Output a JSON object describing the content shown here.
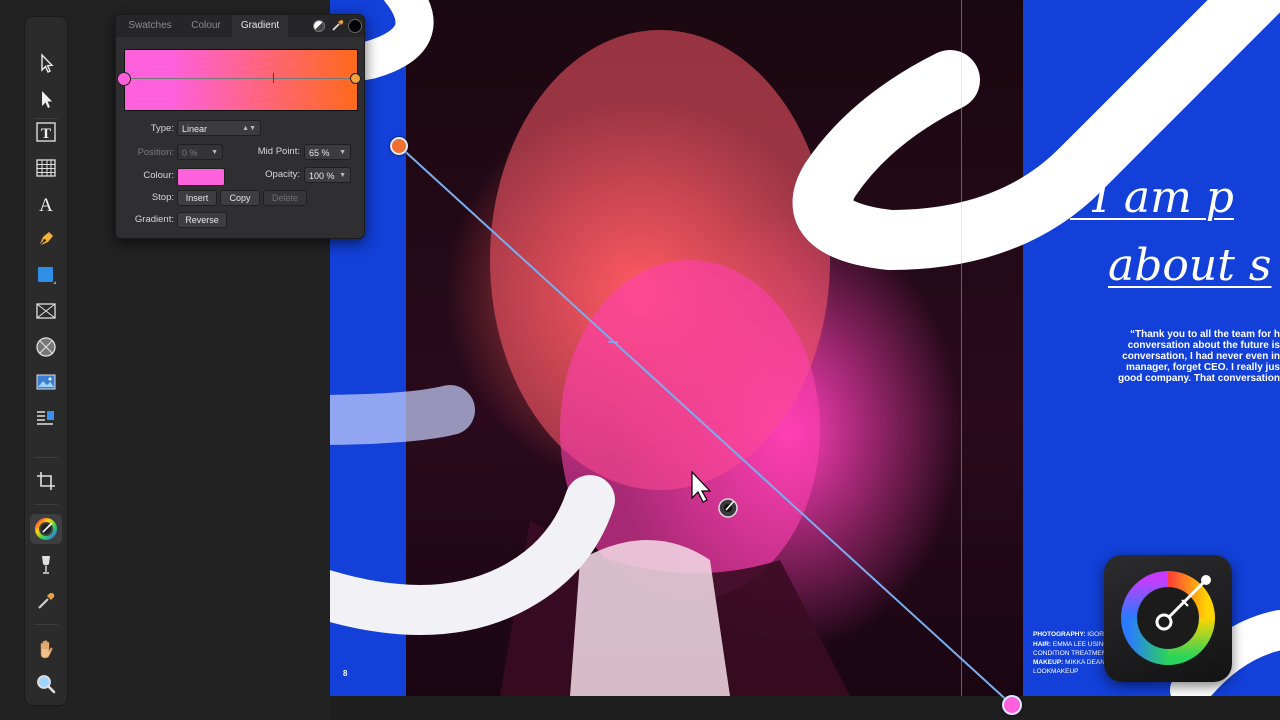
{
  "toolbar": {
    "tools": [
      {
        "name": "move-tool"
      },
      {
        "name": "node-tool"
      },
      {
        "name": "frame-text-tool"
      },
      {
        "name": "table-tool"
      },
      {
        "name": "artistic-text-tool",
        "glyph": "A"
      },
      {
        "name": "pen-tool"
      },
      {
        "name": "shape-tool"
      },
      {
        "name": "picture-frame-tool"
      },
      {
        "name": "ellipse-frame-tool"
      },
      {
        "name": "place-image-tool"
      },
      {
        "name": "text-wrap-tool"
      },
      {
        "name": "crop-tool"
      },
      {
        "name": "fill-tool"
      },
      {
        "name": "transparency-tool"
      },
      {
        "name": "colour-picker-tool"
      },
      {
        "name": "hand-tool"
      },
      {
        "name": "zoom-tool"
      }
    ]
  },
  "gradient_panel": {
    "tabs": [
      "Swatches",
      "Colour",
      "Gradient"
    ],
    "active_tab": "Gradient",
    "gradient_start_color": "#ff60dc",
    "gradient_end_color": "#ff6a1a",
    "type_label": "Type:",
    "type_value": "Linear",
    "position_label": "Position:",
    "position_value": "0 %",
    "midpoint_label": "Mid Point:",
    "midpoint_value": "65 %",
    "colour_label": "Colour:",
    "opacity_label": "Opacity:",
    "opacity_value": "100 %",
    "stop_label": "Stop:",
    "insert_label": "Insert",
    "copy_label": "Copy",
    "delete_label": "Delete",
    "gradient_label": "Gradient:",
    "reverse_label": "Reverse"
  },
  "document": {
    "quote_lines": [
      "“I am p",
      "about s"
    ],
    "body_lines": [
      "“Thank you to all the team for h",
      "conversation about the future is",
      "conversation, I had never even in",
      "manager, forget CEO. I really jus",
      "good company. That conversation"
    ],
    "credits": [
      {
        "label": "PHOTOGRAPHY:",
        "text": " IGOR"
      },
      {
        "label": "HAIR:",
        "text": " EMMA LEE USING"
      },
      {
        "label": "",
        "text": "CONDITION TREATMENT"
      },
      {
        "label": "MAKEUP:",
        "text": " MIKKA DEAN"
      },
      {
        "label": "",
        "text": "LOOKMAKEUP"
      }
    ],
    "page_number": "8"
  },
  "colors": {
    "canvas_blue": "#1240d8",
    "handle_start": "#f07030",
    "handle_end": "#ff60dc",
    "gradient_line": "#6fa4e8"
  }
}
